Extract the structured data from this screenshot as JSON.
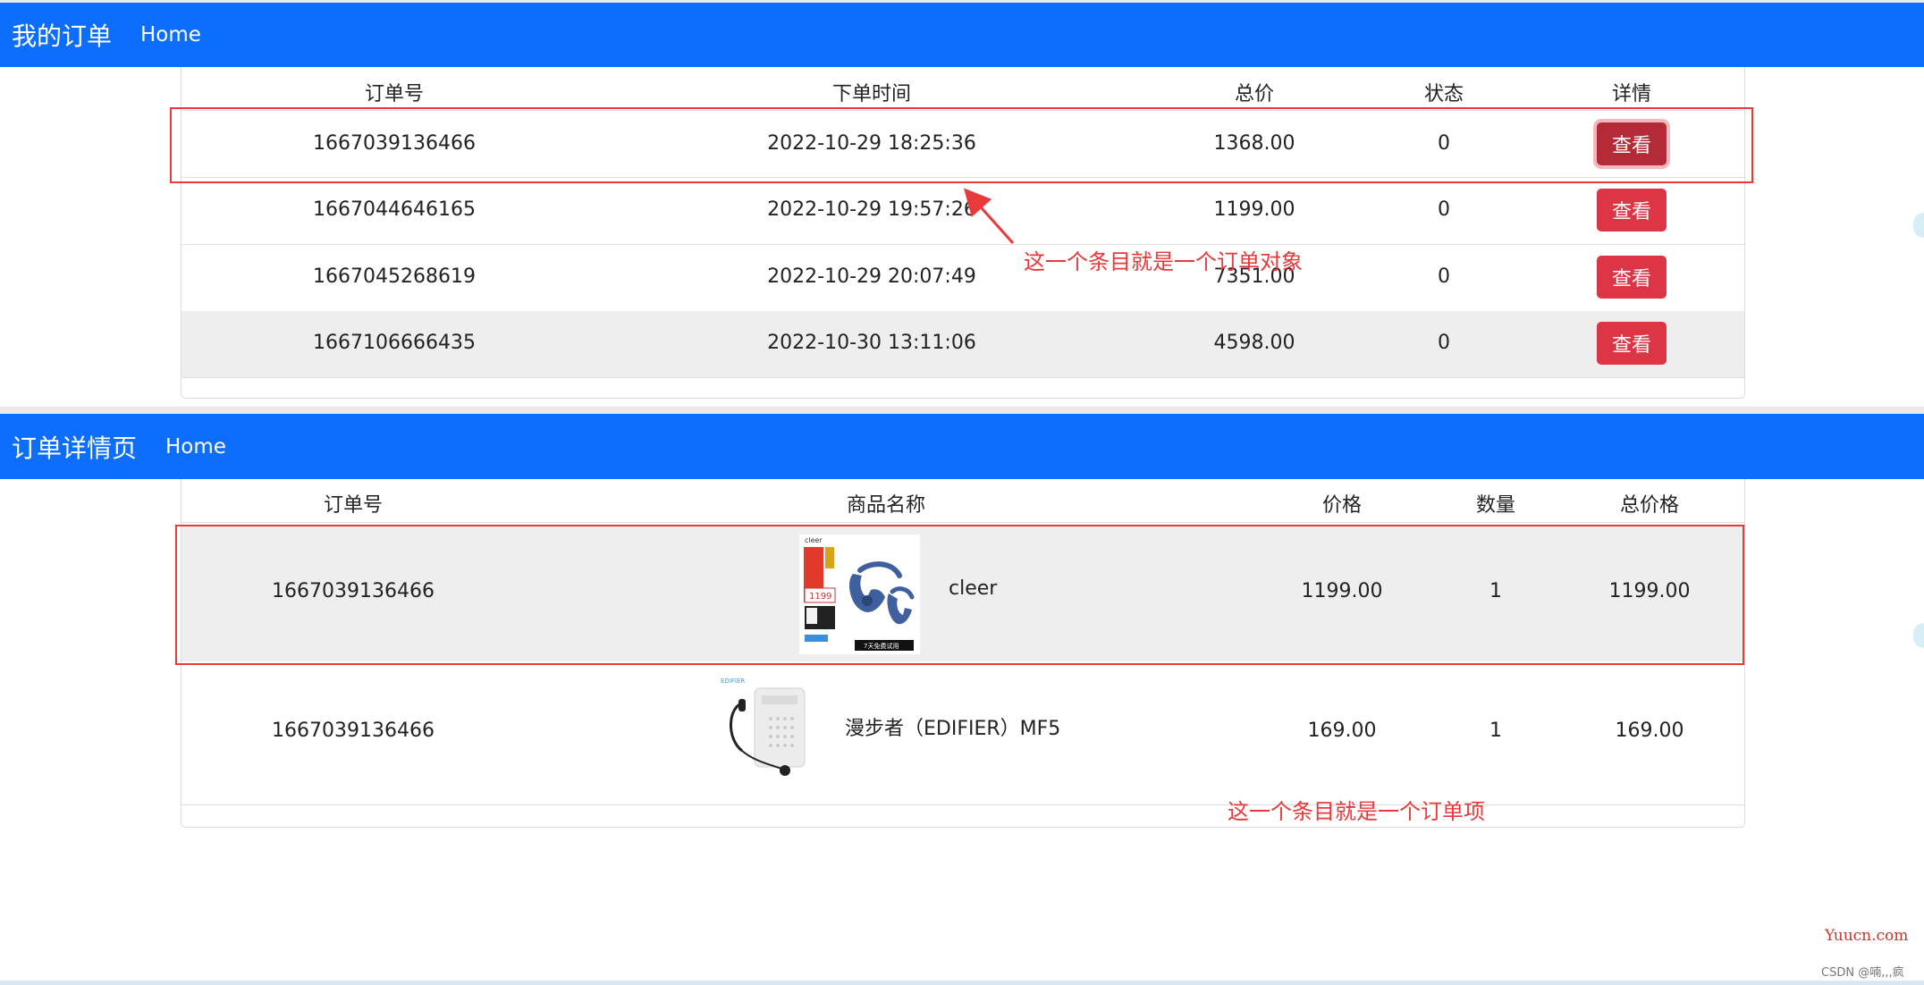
{
  "top_nav": {
    "brand": "我的订单",
    "home": "Home"
  },
  "orders_table": {
    "headers": [
      "订单号",
      "下单时间",
      "总价",
      "状态",
      "详情"
    ],
    "rows": [
      {
        "id": "1667039136466",
        "time": "2022-10-29 18:25:36",
        "total": "1368.00",
        "status": "0",
        "action": "查看"
      },
      {
        "id": "1667044646165",
        "time": "2022-10-29 19:57:26",
        "total": "1199.00",
        "status": "0",
        "action": "查看"
      },
      {
        "id": "1667045268619",
        "time": "2022-10-29 20:07:49",
        "total": "7351.00",
        "status": "0",
        "action": "查看"
      },
      {
        "id": "1667106666435",
        "time": "2022-10-30 13:11:06",
        "total": "4598.00",
        "status": "0",
        "action": "查看"
      }
    ]
  },
  "detail_nav": {
    "brand": "订单详情页",
    "home": "Home"
  },
  "detail_table": {
    "headers": [
      "订单号",
      "商品名称",
      "价格",
      "数量",
      "总价格"
    ],
    "rows": [
      {
        "id": "1667039136466",
        "name": "cleer",
        "price": "1199.00",
        "qty": "1",
        "total": "1199.00"
      },
      {
        "id": "1667039136466",
        "name": "漫步者（EDIFIER）MF5",
        "price": "169.00",
        "qty": "1",
        "total": "169.00"
      }
    ]
  },
  "product_images": {
    "cleer_brand": "cleer",
    "cleer_price": "1199",
    "cleer_trial": "7天免费试用",
    "edifier_brand": "EDIFIER"
  },
  "annotations": {
    "order_object": "这一个条目就是一个订单对象",
    "order_item": "这一个条目就是一个订单项"
  },
  "watermark": "Yuucn.com",
  "csdn_credit": "CSDN @喃,,,疯",
  "colors": {
    "navbar": "#0d6efd",
    "danger": "#dc3545",
    "annotation": "#e8393b"
  }
}
